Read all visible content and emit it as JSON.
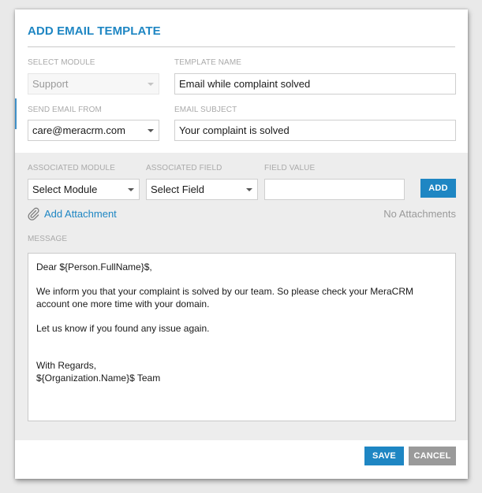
{
  "dialog": {
    "title": "ADD EMAIL TEMPLATE"
  },
  "form": {
    "select_module": {
      "label": "SELECT MODULE",
      "value": "Support"
    },
    "template_name": {
      "label": "TEMPLATE NAME",
      "value": "Email while complaint solved"
    },
    "send_email_from": {
      "label": "SEND EMAIL FROM",
      "value": "care@meracrm.com"
    },
    "email_subject": {
      "label": "EMAIL SUBJECT",
      "value": "Your complaint is solved"
    }
  },
  "associated": {
    "module": {
      "label": "ASSOCIATED MODULE",
      "value": "Select Module"
    },
    "field": {
      "label": "ASSOCIATED FIELD",
      "value": "Select Field"
    },
    "field_value": {
      "label": "FIELD VALUE",
      "value": ""
    },
    "add_label": "ADD"
  },
  "attachment": {
    "add_label": "Add Attachment",
    "status": "No Attachments"
  },
  "message": {
    "label": "MESSAGE",
    "lines": {
      "greeting": "Dear ${Person.FullName}$,",
      "body_1": "We inform you that your complaint is solved by our team. So please check your MeraCRM",
      "body_2": "account one more time with your domain.",
      "body_3": "Let us know if you found any issue again.",
      "closing": "With Regards,",
      "signature": "${Organization.Name}$ Team"
    }
  },
  "footer": {
    "save_label": "SAVE",
    "cancel_label": "CANCEL"
  },
  "colors": {
    "accent": "#1e86c3",
    "cancel": "#9a9a9a",
    "section_bg": "#ededed"
  },
  "icons": {
    "attachment": "paperclip-icon",
    "dropdown": "chevron-down-icon"
  }
}
